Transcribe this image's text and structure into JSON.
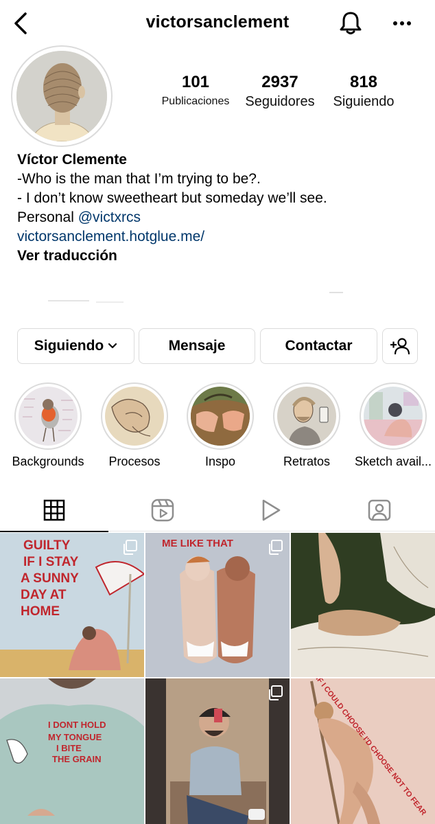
{
  "header": {
    "username": "victorsanclement",
    "icons": {
      "back": "chevron-left-icon",
      "notifications": "bell-icon",
      "more": "more-horizontal-icon"
    }
  },
  "profile": {
    "stats": [
      {
        "number": "101",
        "label": "Publicaciones"
      },
      {
        "number": "2937",
        "label": "Seguidores"
      },
      {
        "number": "818",
        "label": "Siguiendo"
      }
    ],
    "full_name": "Víctor Clemente",
    "bio_line1": "-Who is the man that I’m trying to be?.",
    "bio_line2": "- I don’t know sweetheart but someday we’ll see.",
    "bio_line3_prefix": "Personal ",
    "mention": "@victxrcs",
    "website": "victorsanclement.hotglue.me/",
    "translate": "Ver traducción"
  },
  "actions": {
    "following": "Siguiendo",
    "message": "Mensaje",
    "contact": "Contactar",
    "add_user_icon": "add-user-icon"
  },
  "highlights": [
    {
      "label": "Backgrounds"
    },
    {
      "label": "Procesos"
    },
    {
      "label": "Inspo"
    },
    {
      "label": "Retratos"
    },
    {
      "label": "Sketch avail..."
    }
  ],
  "tabs": [
    {
      "icon": "grid-icon",
      "active": true
    },
    {
      "icon": "reels-icon",
      "active": false
    },
    {
      "icon": "play-icon",
      "active": false
    },
    {
      "icon": "tagged-icon",
      "active": false
    }
  ],
  "posts": [
    {
      "painted_text": [
        "GUILTY",
        "IF I STAY",
        "A SUNNY",
        "DAY AT",
        "HOME"
      ],
      "multiple": true
    },
    {
      "painted_text": [
        "ME LIKE THAT"
      ],
      "multiple": true
    },
    {
      "painted_text": [],
      "multiple": false
    },
    {
      "painted_text": [
        "I DONT HOLD",
        "MY TONGUE",
        "I BITE",
        "THE GRAIN"
      ],
      "multiple": false
    },
    {
      "painted_text": [],
      "multiple": true
    },
    {
      "painted_text": [
        "IF I COULD CHOOSE I'D CHOOSE NOT TO FEAR"
      ],
      "multiple": false
    }
  ],
  "colors": {
    "link": "#00376b",
    "border": "#dbdbdb",
    "painted_text": "#c0262d"
  }
}
